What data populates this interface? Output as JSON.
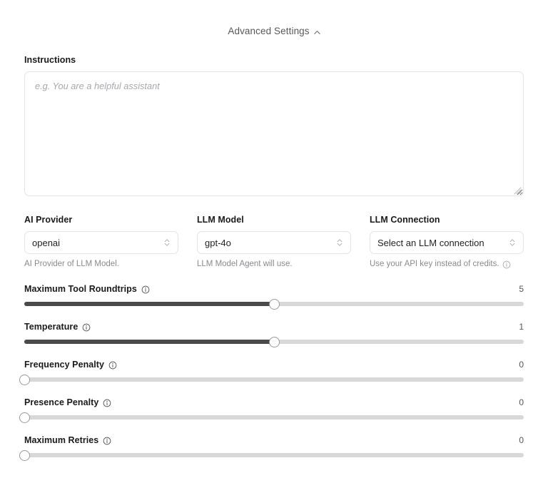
{
  "header": {
    "title": "Advanced Settings",
    "toggle_icon": "chevron-up-icon"
  },
  "instructions": {
    "label": "Instructions",
    "value": "",
    "placeholder": "e.g. You are a helpful assistant"
  },
  "selects": [
    {
      "label": "AI Provider",
      "value": "openai",
      "helper": "AI Provider of LLM Model.",
      "helper_icon": null,
      "icon": "chevron-updown-icon"
    },
    {
      "label": "LLM Model",
      "value": "gpt-4o",
      "helper": "LLM Model Agent will use.",
      "helper_icon": null,
      "icon": "chevron-updown-icon"
    },
    {
      "label": "LLM Connection",
      "value": "Select an LLM connection",
      "helper": "Use your API key instead of credits.",
      "helper_icon": "info-icon",
      "icon": "chevron-updown-icon"
    }
  ],
  "sliders": [
    {
      "label": "Maximum Tool Roundtrips",
      "info_icon": "info-icon",
      "value": "5",
      "percent": 50
    },
    {
      "label": "Temperature",
      "info_icon": "info-icon",
      "value": "1",
      "percent": 50
    },
    {
      "label": "Frequency Penalty",
      "info_icon": "info-icon",
      "value": "0",
      "percent": 0
    },
    {
      "label": "Presence Penalty",
      "info_icon": "info-icon",
      "value": "0",
      "percent": 0
    },
    {
      "label": "Maximum Retries",
      "info_icon": "info-icon",
      "value": "0",
      "percent": 0
    }
  ],
  "colors": {
    "track": "#d8d8d8",
    "fill": "#4a4a4a",
    "border": "#e4e4e7",
    "muted_text": "#8a8a8f"
  }
}
